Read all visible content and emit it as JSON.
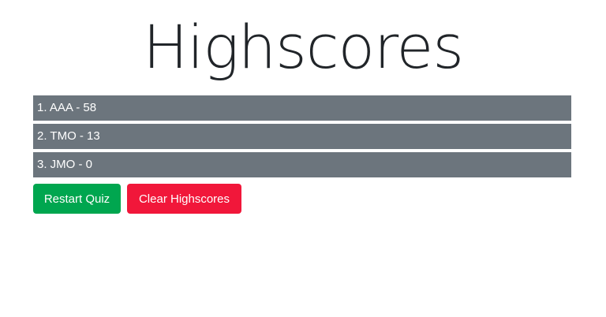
{
  "page": {
    "title": "Highscores"
  },
  "scores": [
    {
      "label": "1. AAA - 58"
    },
    {
      "label": "2. TMO - 13"
    },
    {
      "label": "3. JMO - 0"
    }
  ],
  "actions": {
    "restart_label": "Restart Quiz",
    "clear_label": "Clear Highscores"
  },
  "colors": {
    "row_background": "#6c757d",
    "restart_button": "#00a64f",
    "clear_button": "#f1173a",
    "title_text": "#212529"
  }
}
